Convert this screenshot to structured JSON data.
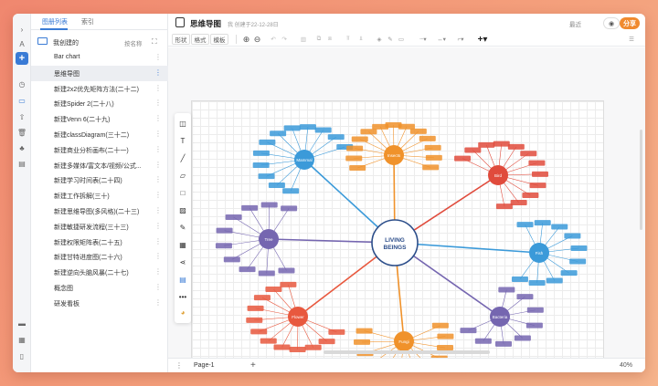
{
  "sidebar": {
    "tabs": [
      "图册列表",
      "索引"
    ],
    "folder_name": "我创建的",
    "sort_label": "按名称",
    "items": [
      {
        "label": "Bar chart"
      },
      {
        "label": "思维导图"
      },
      {
        "label": "新建2x2优先矩阵方法(二十二)"
      },
      {
        "label": "新建Spider 2(二十八)"
      },
      {
        "label": "新建Venn 6(二十九)"
      },
      {
        "label": "新建classDiagram(三十二)"
      },
      {
        "label": "新建商业分析画布(二十一)"
      },
      {
        "label": "新建多媒体/富文本/视频/公式..."
      },
      {
        "label": "新建学习时间表(二十四)"
      },
      {
        "label": "新建工作拆解(三十)"
      },
      {
        "label": "新建思维导图(多风格)(二十三)"
      },
      {
        "label": "新建敏捷研发流程(三十三)"
      },
      {
        "label": "新建权限矩阵表(二十五)"
      },
      {
        "label": "新建甘特进度图(二十六)"
      },
      {
        "label": "新建逆向头脑风暴(二十七)"
      },
      {
        "label": "概念图"
      },
      {
        "label": "研发看板"
      }
    ],
    "selected_index": 1
  },
  "rail": {
    "letter": "A"
  },
  "header": {
    "title": "思维导图",
    "meta": "我 创建于22-12-28日",
    "recent": "最近",
    "share": "分享"
  },
  "toolbar": {
    "shape": "形状",
    "format": "格式",
    "template": "模板"
  },
  "mindmap": {
    "center": "LIVING\nBEINGS",
    "branches": [
      {
        "label": "Mammal",
        "color": "#3b9ad9"
      },
      {
        "label": "Insects",
        "color": "#f0922b"
      },
      {
        "label": "Bird",
        "color": "#e04b3c"
      },
      {
        "label": "Tree",
        "color": "#7566b0"
      },
      {
        "label": "Fish",
        "color": "#3b9ad9"
      },
      {
        "label": "Flower",
        "color": "#e8583e"
      },
      {
        "label": "Fungi",
        "color": "#f0922b"
      },
      {
        "label": "Bacteria",
        "color": "#7566b0"
      }
    ]
  },
  "footer": {
    "page_tab": "Page-1",
    "zoom": "40%"
  }
}
